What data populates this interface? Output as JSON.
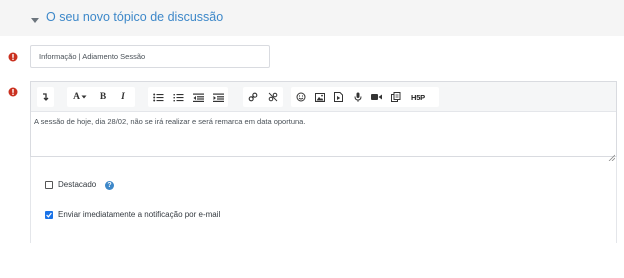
{
  "section": {
    "title": "O seu novo tópico de discussão"
  },
  "subject": {
    "value": "Informação | Adiamento Sessão"
  },
  "editor": {
    "toolbar": {
      "groups": [
        [
          "collapse-icon"
        ],
        [
          "font-size-icon",
          "bold-icon",
          "italic-icon"
        ],
        [
          "unordered-list-icon",
          "ordered-list-icon",
          "outdent-icon",
          "indent-icon"
        ],
        [
          "link-icon",
          "unlink-icon"
        ],
        [
          "emoji-icon",
          "image-icon",
          "media-icon",
          "record-audio-icon",
          "record-video-icon",
          "manage-files-icon",
          "h5p-icon"
        ]
      ],
      "labels": {
        "bold": "B",
        "italic": "I",
        "font": "A",
        "h5p": "H5P"
      }
    },
    "content": "A sessão de hoje, dia 28/02, não se irá realizar e será remarca em data oportuna."
  },
  "options": {
    "pinned": {
      "label": "Destacado",
      "checked": false
    },
    "notify": {
      "label": "Enviar imediatamente a notificação por e-mail",
      "checked": true
    }
  },
  "colors": {
    "accent": "#3d88c9",
    "required": "#ca3120",
    "checkbox_checked": "#1a73e8",
    "header_bg": "#f5f5f5"
  }
}
